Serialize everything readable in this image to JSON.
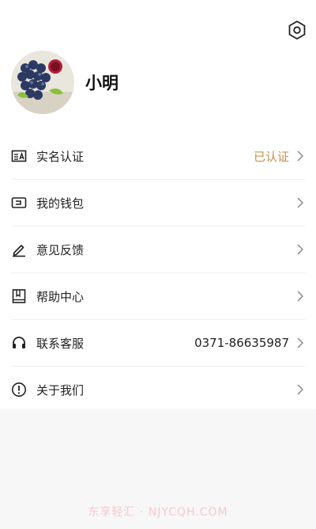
{
  "profile": {
    "name": "小明"
  },
  "menu": [
    {
      "label": "实名认证",
      "value": "已认证",
      "icon": "id-card-icon"
    },
    {
      "label": "我的钱包",
      "value": "",
      "icon": "wallet-icon"
    },
    {
      "label": "意见反馈",
      "value": "",
      "icon": "edit-icon"
    },
    {
      "label": "帮助中心",
      "value": "",
      "icon": "book-icon"
    },
    {
      "label": "联系客服",
      "value": "0371-86635987",
      "icon": "headset-icon"
    },
    {
      "label": "关于我们",
      "value": "",
      "icon": "info-icon"
    }
  ],
  "watermark": "东享轻汇 · NJYCQH.COM",
  "colors": {
    "verified": "#c8904b",
    "background": "#f7f7f7"
  }
}
